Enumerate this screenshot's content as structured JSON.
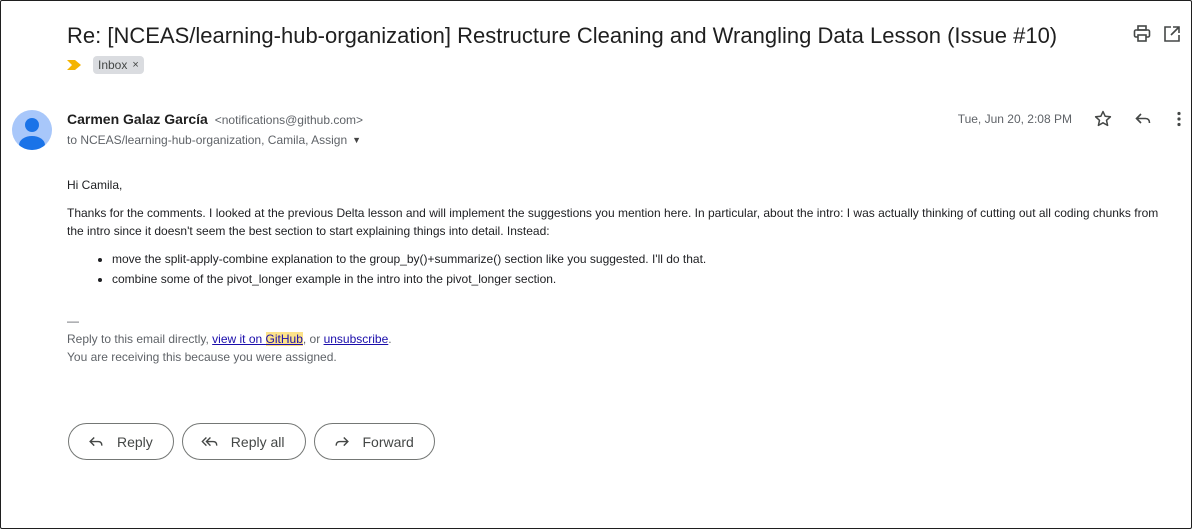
{
  "email": {
    "subject": "Re: [NCEAS/learning-hub-organization] Restructure Cleaning and Wrangling Data Lesson (Issue #10)",
    "labels": [
      {
        "text": "Inbox",
        "remove": "×"
      }
    ],
    "sender_name": "Carmen Galaz García",
    "sender_email": "<notifications@github.com>",
    "recipients": "to NCEAS/learning-hub-organization, Camila, Assign",
    "date": "Tue, Jun 20, 2:08 PM",
    "greeting": "Hi Camila,",
    "paragraph": "Thanks for the comments. I looked at the previous Delta lesson and will implement the suggestions you mention here. In particular, about the intro: I was actually thinking of cutting out all coding chunks from the intro since it doesn't seem the best section to start explaining things into detail. Instead:",
    "bullets": [
      "move the split-apply-combine explanation to the group_by()+summarize() section like you suggested. I'll do that.",
      "combine some of the pivot_longer example in the intro into the pivot_longer section."
    ]
  },
  "footer": {
    "separator": "—",
    "reply_prefix": "Reply to this email directly, ",
    "view_link_prefix": "view it on ",
    "view_link_highlight": "GitHub",
    "middle": ", or ",
    "unsubscribe": "unsubscribe",
    "end": ".",
    "reason": "You are receiving this because you were assigned."
  },
  "actions": {
    "reply": "Reply",
    "reply_all": "Reply all",
    "forward": "Forward"
  },
  "icons": [
    "print-icon",
    "open-in-new-window-icon",
    "importance-marker-icon",
    "avatar",
    "star-icon",
    "reply-icon",
    "more-vert-icon"
  ],
  "colors": {
    "importance": "#f4b400",
    "avatar": "#a8c7fa",
    "avatar_figure": "#1a73e8",
    "link": "#1a0dab",
    "highlight": "#fce28a"
  }
}
